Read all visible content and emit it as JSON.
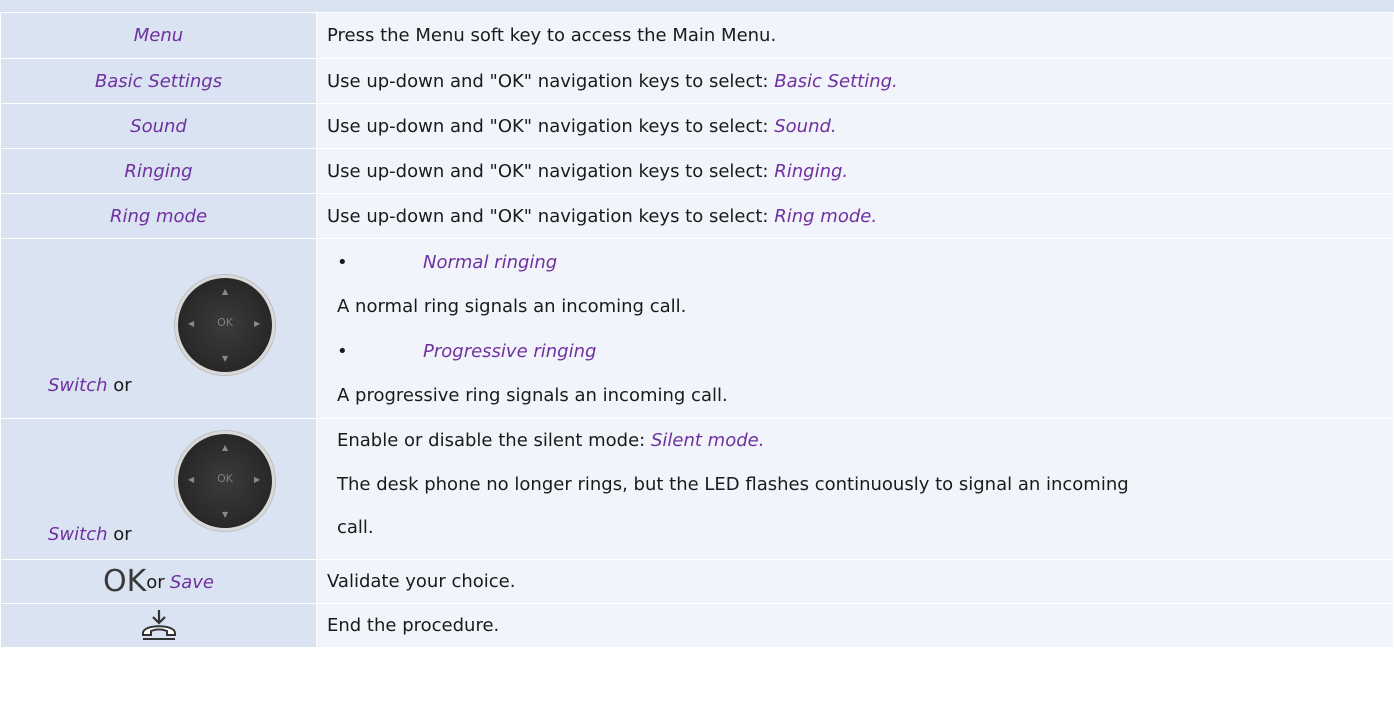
{
  "rows": [
    {
      "left": "Menu",
      "right": "Press the Menu soft key to access the Main Menu."
    },
    {
      "left": "Basic Settings",
      "right_prefix": "Use up-down and \"OK\" navigation keys to select: ",
      "right_italic": "Basic Setting."
    },
    {
      "left": "Sound",
      "right_prefix": "Use up-down and \"OK\" navigation keys to select: ",
      "right_italic": "Sound."
    },
    {
      "left": "Ringing",
      "right_prefix": "Use up-down and \"OK\" navigation keys to select: ",
      "right_italic": "Ringing."
    },
    {
      "left": "Ring mode",
      "right_prefix": "Use up-down and \"OK\" navigation keys to select: ",
      "right_italic": "Ring mode."
    }
  ],
  "ring_options": {
    "switch": "Switch",
    "or": "or",
    "navpad_ok": "OK",
    "bullet": "•",
    "option1": "Normal ringing",
    "option1_desc": "A normal ring signals an incoming call.",
    "option2": "Progressive ringing",
    "option2_desc": "A progressive ring signals an incoming call."
  },
  "silent": {
    "switch": "Switch",
    "or": "or",
    "navpad_ok": "OK",
    "line1_prefix": "Enable or disable the silent mode: ",
    "line1_italic": "Silent mode.",
    "line2": "The desk phone no longer rings, but the LED flashes continuously to signal an incoming",
    "line3": "call."
  },
  "validate": {
    "ok_key": "OK",
    "or": "or",
    "save": "Save",
    "text": "Validate your choice."
  },
  "end": {
    "icon": "hang-up-icon",
    "text": "End the procedure."
  },
  "colors": {
    "left_bg": "#dae3f1",
    "right_bg": "#f1f4fa",
    "accent": "#7030a0"
  }
}
